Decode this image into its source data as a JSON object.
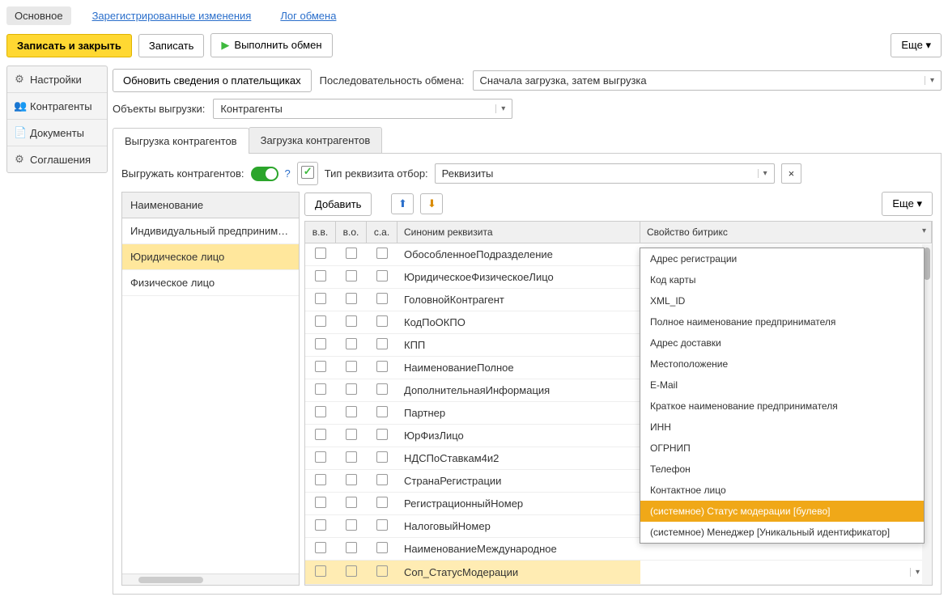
{
  "topNav": {
    "main": "Основное",
    "registered": "Зарегистрированные изменения",
    "log": "Лог обмена"
  },
  "actions": {
    "saveClose": "Записать и закрыть",
    "save": "Записать",
    "runExchange": "Выполнить обмен",
    "more": "Еще"
  },
  "sidebar": {
    "items": [
      {
        "icon": "⚙",
        "label": "Настройки"
      },
      {
        "icon": "👥",
        "label": "Контрагенты"
      },
      {
        "icon": "📄",
        "label": "Документы"
      },
      {
        "icon": "⚙",
        "label": "Соглашения"
      }
    ]
  },
  "toolbar": {
    "updatePayers": "Обновить сведения о плательщиках",
    "orderLabel": "Последовательность обмена:",
    "orderValue": "Сначала загрузка, затем выгрузка",
    "objectsLabel": "Объекты выгрузки:",
    "objectsValue": "Контрагенты"
  },
  "tabs": {
    "export": "Выгрузка контрагентов",
    "import": "Загрузка контрагентов"
  },
  "exportPane": {
    "unloadLabel": "Выгружать контрагентов:",
    "reqTypeLabel": "Тип реквизита отбор:",
    "reqTypeValue": "Реквизиты",
    "nameHeader": "Наименование",
    "nameItems": [
      "Индивидуальный предприниматель",
      "Юридическое лицо",
      "Физическое лицо"
    ],
    "add": "Добавить",
    "more": "Еще",
    "gridHeaders": {
      "vv": "в.в.",
      "vo": "в.о.",
      "sa": "с.а.",
      "syn": "Синоним реквизита",
      "prop": "Свойство битрикс"
    },
    "rows": [
      "ОбособленноеПодразделение",
      "ЮридическоеФизическоеЛицо",
      "ГоловнойКонтрагент",
      "КодПоОКПО",
      "КПП",
      "НаименованиеПолное",
      "ДополнительнаяИнформация",
      "Партнер",
      "ЮрФизЛицо",
      "НДСПоСтавкам4и2",
      "СтранаРегистрации",
      "РегистрационныйНомер",
      "НалоговыйНомер",
      "НаименованиеМеждународное",
      "Соп_СтатусМодерации"
    ],
    "dropdown": [
      "Адрес регистрации",
      "Код карты",
      "XML_ID",
      "Полное наименование предпринимателя",
      "Адрес доставки",
      "Местоположение",
      "E-Mail",
      "Краткое наименование предпринимателя",
      "ИНН",
      "ОГРНИП",
      "Телефон",
      "Контактное лицо",
      "(системное) Статус модерации [булево]",
      "(системное) Менеджер [Уникальный идентификатор]"
    ]
  }
}
